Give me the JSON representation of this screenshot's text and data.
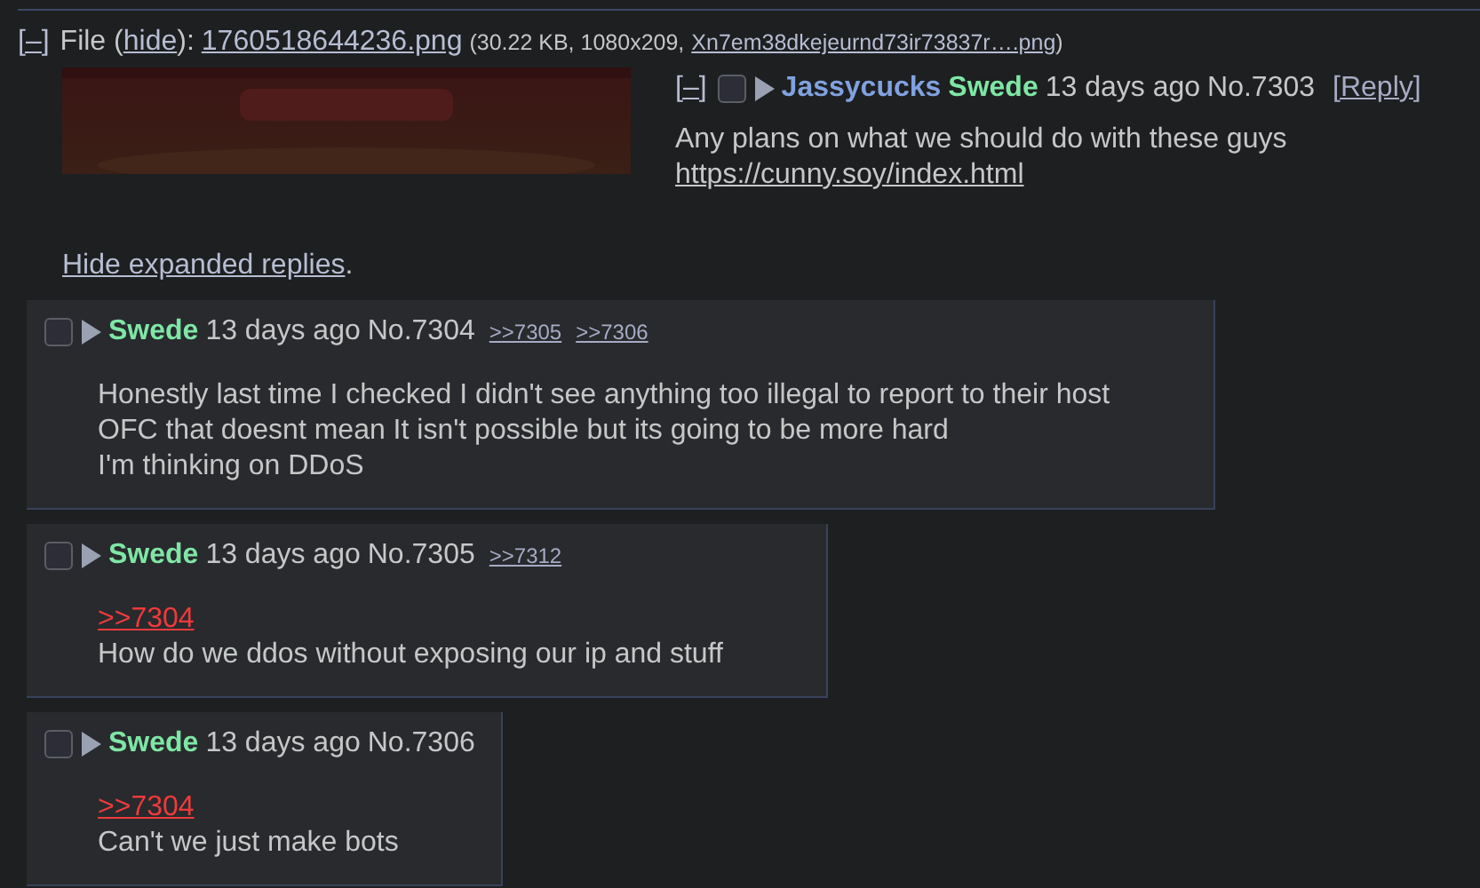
{
  "file": {
    "toggle": "[–]",
    "segments": [
      {
        "kind": "text",
        "text": "File ("
      },
      {
        "kind": "link",
        "text": "hide"
      },
      {
        "kind": "text",
        "text": "):"
      },
      {
        "kind": "link",
        "text": "1760518644236.png"
      },
      {
        "kind": "small_text",
        "text": "(30.22 KB, 1080x209,"
      },
      {
        "kind": "small_link",
        "text": "Xn7em38dkejeurnd73ir73837r….png"
      },
      {
        "kind": "small_text",
        "text": ")"
      }
    ]
  },
  "op": {
    "kind": "op",
    "toggle": "[–]",
    "checked": false,
    "name": "Jassycucks",
    "tag": "Swede",
    "date": "13 days ago",
    "number": "No.7303",
    "reply_link": "[Reply]",
    "body": [
      {
        "kind": "text",
        "text": "Any plans on what we should do with these guys"
      },
      {
        "kind": "link",
        "text": "https://cunny.soy/index.html"
      }
    ]
  },
  "hide_replies": {
    "link": "Hide expanded replies",
    "after": "."
  },
  "replies": [
    {
      "kind": "reply",
      "checked": false,
      "tag": "Swede",
      "date": "13 days ago",
      "number": "No.7304",
      "backlinks": [
        ">>7305",
        ">>7306"
      ],
      "body": [
        {
          "kind": "text",
          "text": "Honestly last time I checked I didn't see anything too illegal to report to their host"
        },
        {
          "kind": "text",
          "text": "OFC that doesnt mean It isn't possible but its going to be more hard"
        },
        {
          "kind": "text",
          "text": "I'm thinking on DDoS"
        }
      ]
    },
    {
      "kind": "reply",
      "checked": false,
      "tag": "Swede",
      "date": "13 days ago",
      "number": "No.7305",
      "backlinks": [
        ">>7312"
      ],
      "body": [
        {
          "kind": "quote",
          "text": ">>7304"
        },
        {
          "kind": "text",
          "text": "How do we ddos without exposing our ip and stuff"
        }
      ]
    },
    {
      "kind": "reply",
      "checked": false,
      "tag": "Swede",
      "date": "13 days ago",
      "number": "No.7306",
      "body": [
        {
          "kind": "quote",
          "text": ">>7304"
        },
        {
          "kind": "text",
          "text": "Can't we just make bots"
        }
      ]
    }
  ]
}
